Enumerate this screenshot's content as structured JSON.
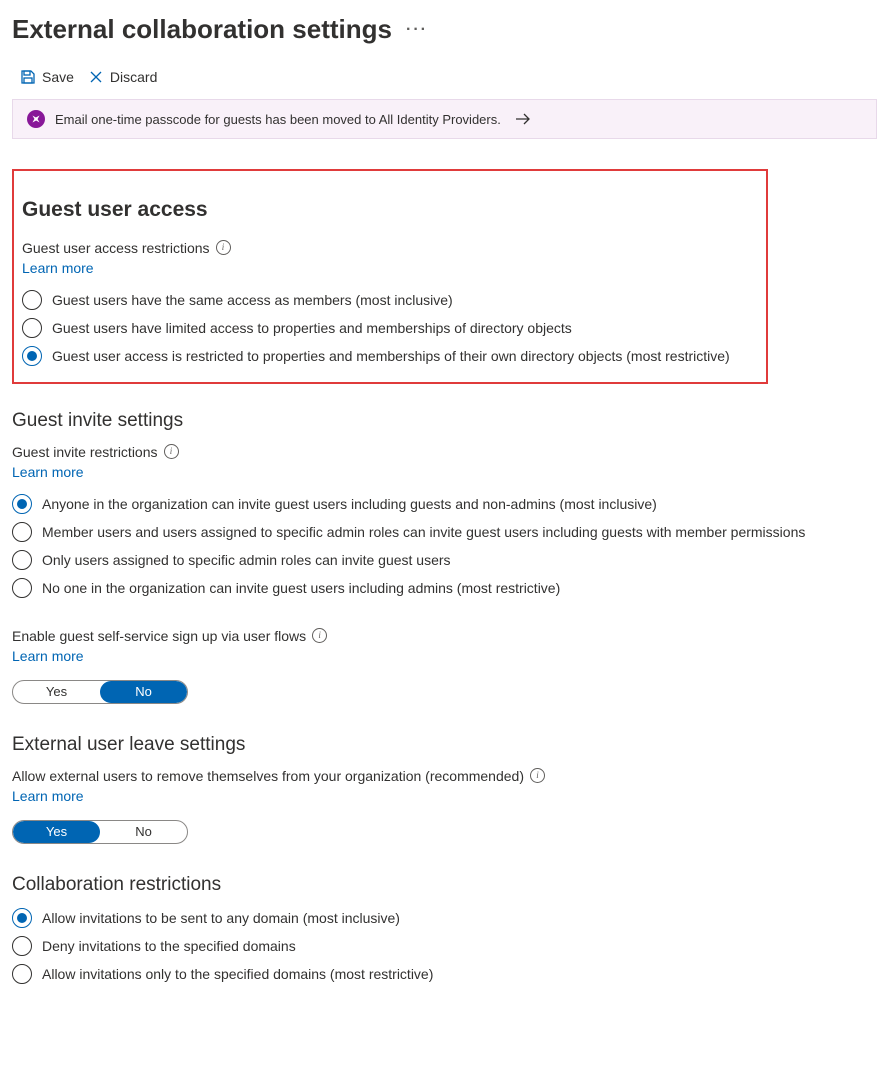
{
  "page": {
    "title": "External collaboration settings",
    "more_glyph": "···"
  },
  "toolbar": {
    "save_label": "Save",
    "discard_label": "Discard"
  },
  "banner": {
    "text": "Email one-time passcode for guests has been moved to All Identity Providers."
  },
  "guest_access": {
    "heading": "Guest user access",
    "subtitle": "Guest user access restrictions",
    "learn_more": "Learn more",
    "options": [
      "Guest users have the same access as members (most inclusive)",
      "Guest users have limited access to properties and memberships of directory objects",
      "Guest user access is restricted to properties and memberships of their own directory objects (most restrictive)"
    ],
    "selected_index": 2
  },
  "guest_invite": {
    "heading": "Guest invite settings",
    "subtitle": "Guest invite restrictions",
    "learn_more": "Learn more",
    "options": [
      "Anyone in the organization can invite guest users including guests and non-admins (most inclusive)",
      "Member users and users assigned to specific admin roles can invite guest users including guests with member permissions",
      "Only users assigned to specific admin roles can invite guest users",
      "No one in the organization can invite guest users including admins (most restrictive)"
    ],
    "selected_index": 0
  },
  "self_service": {
    "subtitle": "Enable guest self-service sign up via user flows",
    "learn_more": "Learn more",
    "yes": "Yes",
    "no": "No",
    "value": "No"
  },
  "external_leave": {
    "heading": "External user leave settings",
    "subtitle": "Allow external users to remove themselves from your organization (recommended)",
    "learn_more": "Learn more",
    "yes": "Yes",
    "no": "No",
    "value": "Yes"
  },
  "collab_restrictions": {
    "heading": "Collaboration restrictions",
    "options": [
      "Allow invitations to be sent to any domain (most inclusive)",
      "Deny invitations to the specified domains",
      "Allow invitations only to the specified domains (most restrictive)"
    ],
    "selected_index": 0
  }
}
